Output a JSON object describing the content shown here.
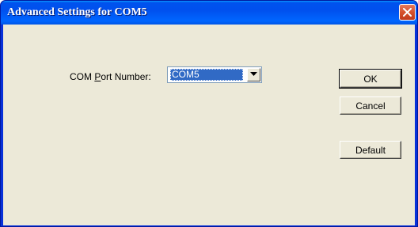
{
  "window": {
    "title": "Advanced Settings for COM5",
    "close_icon": "close-icon"
  },
  "form": {
    "port_label_prefix": "COM ",
    "port_label_accel": "P",
    "port_label_suffix": "ort Number:",
    "port_value": "COM5"
  },
  "buttons": {
    "ok": "OK",
    "cancel": "Cancel",
    "default": "Default"
  }
}
